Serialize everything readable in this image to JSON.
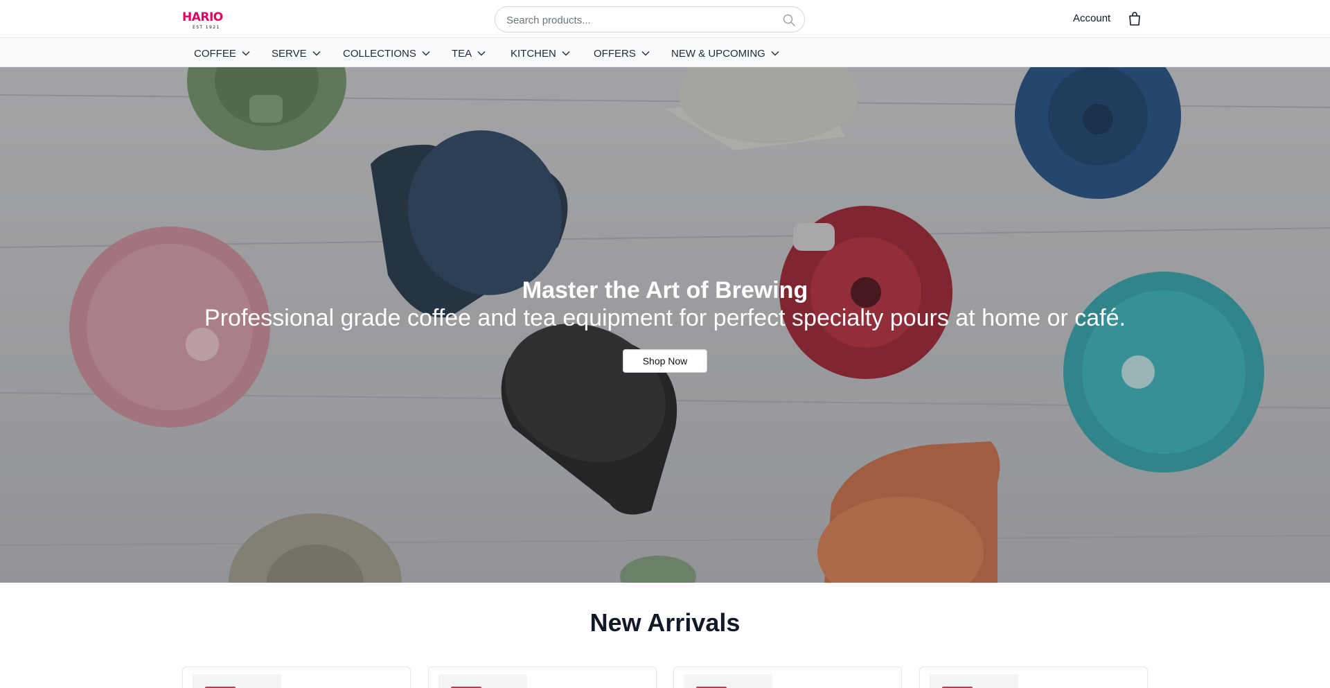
{
  "brand": {
    "logo_text": "HARIO",
    "logo_sub": "EST 1921",
    "logo_color": "#e0005e"
  },
  "search": {
    "placeholder": "Search products...",
    "value": "",
    "icon": "search-icon"
  },
  "header": {
    "account_label": "Account",
    "cart_icon": "shopping-bag-icon"
  },
  "nav": {
    "items": [
      {
        "label": "COFFEE"
      },
      {
        "label": "SERVE"
      },
      {
        "label": "COLLECTIONS"
      },
      {
        "label": "TEA"
      },
      {
        "label": "KITCHEN"
      },
      {
        "label": "OFFERS"
      },
      {
        "label": "NEW & UPCOMING"
      }
    ],
    "dropdown_icon": "chevron-down-icon"
  },
  "hero": {
    "title": "Master the Art of Brewing",
    "subtitle": "Professional grade coffee and tea equipment for perfect specialty pours at home or café.",
    "cta_label": "Shop Now"
  },
  "new_arrivals": {
    "title": "New Arrivals",
    "products": [
      {
        "name": "",
        "price": ""
      },
      {
        "name": "",
        "price": ""
      },
      {
        "name": "",
        "price": ""
      },
      {
        "name": "",
        "price": ""
      }
    ]
  }
}
